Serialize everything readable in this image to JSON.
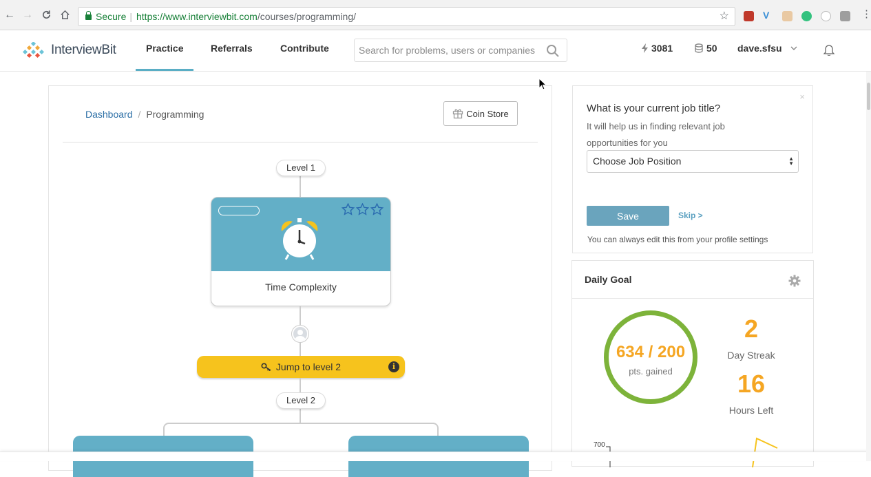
{
  "browser": {
    "secure_label": "Secure",
    "url_host": "https://www.interviewbit.com",
    "url_path": "/courses/programming/"
  },
  "header": {
    "logo_text": "InterviewBit",
    "nav": [
      {
        "label": "Practice",
        "active": true
      },
      {
        "label": "Referrals",
        "active": false
      },
      {
        "label": "Contribute",
        "active": false
      }
    ],
    "search_placeholder": "Search for problems, users or companies",
    "streak_points": "3081",
    "coins": "50",
    "username": "dave.sfsu"
  },
  "breadcrumb": {
    "root": "Dashboard",
    "separator": "/",
    "current": "Programming"
  },
  "coin_store_label": "Coin Store",
  "levels": {
    "level1_label": "Level 1",
    "level2_label": "Level 2"
  },
  "topic": {
    "title": "Time Complexity",
    "stars": 3,
    "stars_filled": 0,
    "progress": 0
  },
  "jump_button_label": "Jump to level 2",
  "jump_info_icon": "i",
  "job_prompt": {
    "question": "What is your current job title?",
    "help": "It will help us in finding relevant job opportunities for you",
    "select_value": "Choose Job Position",
    "save_label": "Save",
    "skip_label": "Skip >",
    "footer": "You can always edit this from your profile settings",
    "close_icon": "×"
  },
  "daily_goal": {
    "title": "Daily Goal",
    "points_value": "634 / 200",
    "points_label": "pts. gained",
    "streak_value": "2",
    "streak_label": "Day Streak",
    "hours_value": "16",
    "hours_label": "Hours Left",
    "chart_axis_tick": "700"
  },
  "colors": {
    "accent": "#63afc7",
    "jump_yellow": "#f6c31d",
    "goal_orange": "#f5a623",
    "ring_green": "#7db33a"
  }
}
